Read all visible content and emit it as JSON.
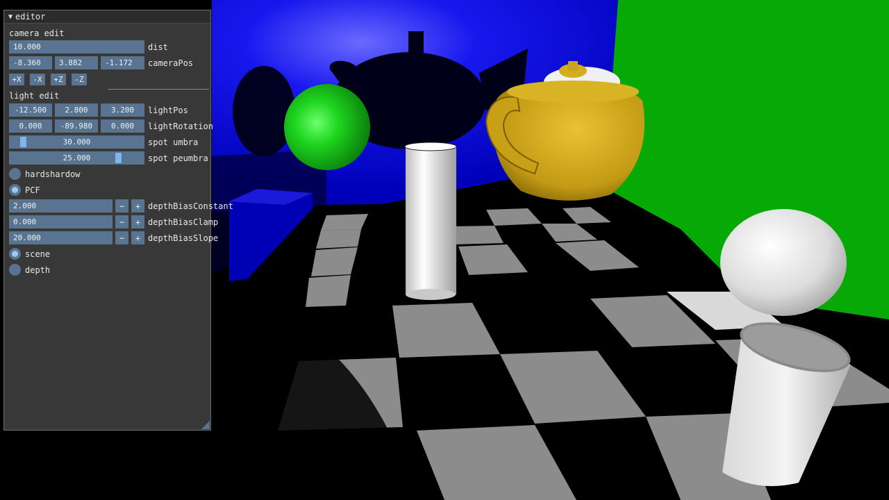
{
  "window": {
    "title": "editor",
    "collapse_icon": "triangle-down-icon"
  },
  "camera": {
    "header": "camera edit",
    "dist": {
      "value": "10.000",
      "label": "dist"
    },
    "pos": {
      "x": "-8.360",
      "y": "3.882",
      "z": "-1.172",
      "label": "cameraPos"
    },
    "buttons": [
      "+X",
      "-X",
      "+Z",
      "-Z"
    ]
  },
  "light": {
    "header": "light edit",
    "pos": {
      "x": "-12.500",
      "y": "2.800",
      "z": "3.200",
      "label": "lightPos"
    },
    "rotation": {
      "x": "0.000",
      "y": "-89.980",
      "z": "0.000",
      "label": "lightRotation"
    },
    "umbra": {
      "value": "30.000",
      "label": "spot umbra",
      "fraction": 0.1
    },
    "penumbra": {
      "value": "25.000",
      "label": "spot peumbra",
      "fraction": 0.83
    }
  },
  "shadow_mode": {
    "options": [
      {
        "label": "hardshardow",
        "selected": false
      },
      {
        "label": "PCF",
        "selected": true
      }
    ]
  },
  "bias": {
    "minus": "−",
    "plus": "+",
    "constant": {
      "value": "2.000",
      "label": "depthBiasConstant"
    },
    "clamp": {
      "value": "0.000",
      "label": "depthBiasClamp"
    },
    "slope": {
      "value": "20.000",
      "label": "depthBiasSlope"
    }
  },
  "view_mode": {
    "options": [
      {
        "label": "scene",
        "selected": true
      },
      {
        "label": "depth",
        "selected": false
      }
    ]
  },
  "scene": {
    "colors": {
      "blue_wall": "#0a0af0",
      "green_wall": "#06a806",
      "teapot": "#d4b21e",
      "sphere_green": "#18d218",
      "white": "#e6e6e6",
      "floor_light": "#8c8c8c"
    }
  }
}
